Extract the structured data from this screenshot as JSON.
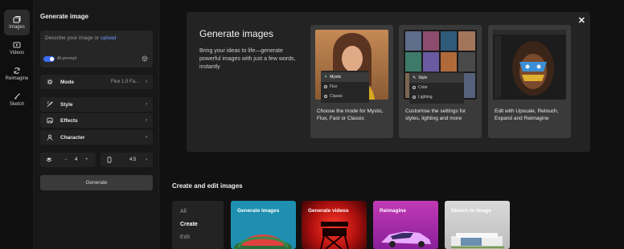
{
  "rail": {
    "items": [
      {
        "label": "Images",
        "icon": "image-stack-icon",
        "active": true
      },
      {
        "label": "Videos",
        "icon": "video-icon",
        "active": false
      },
      {
        "label": "Reimagine",
        "icon": "refresh-icon",
        "active": false
      },
      {
        "label": "Sketch",
        "icon": "brush-icon",
        "active": false
      }
    ]
  },
  "panel": {
    "title": "Generate image",
    "prompt_placeholder": "Describe your image or",
    "prompt_link": "upload",
    "ai_prompt_label": "AI-prompt",
    "ai_prompt_on": true,
    "mode_label": "Mode",
    "mode_value": "Flux 1.0 Fa...",
    "style_label": "Style",
    "effects_label": "Effects",
    "character_label": "Character",
    "count_minus": "−",
    "count_value": "4",
    "count_plus": "+",
    "aspect_value": "4:5",
    "generate_label": "Generate"
  },
  "dialog": {
    "close": "✕",
    "title": "Generate images",
    "description": "Bring your ideas to life—generate powerful images with just a few words, instantly",
    "cards": [
      {
        "caption": "Choose the mode for Mystic, Flux, Fast or Classic",
        "menu": [
          "Mystic",
          "Flux",
          "Classic"
        ]
      },
      {
        "caption": "Customise the settings for styles, lighting and more",
        "menu": [
          "Style",
          "Color",
          "Lighting"
        ]
      },
      {
        "caption": "Edit with Upscale, Retouch, Expand and Reimagine"
      }
    ]
  },
  "section": {
    "title": "Create and edit images",
    "categories": [
      "All",
      "Create",
      "Edit"
    ],
    "active_category": "Create",
    "tiles": [
      "Generate images",
      "Generate videos",
      "Reimagine",
      "Sketch to image"
    ]
  },
  "colors": {
    "accent": "#3b6df0",
    "link": "#6e9bff",
    "tile_teal": "#1e8fb0",
    "tile_red": "#c91a1a",
    "tile_pink": "#c13ab5",
    "tile_grey": "#cfcfcf"
  }
}
